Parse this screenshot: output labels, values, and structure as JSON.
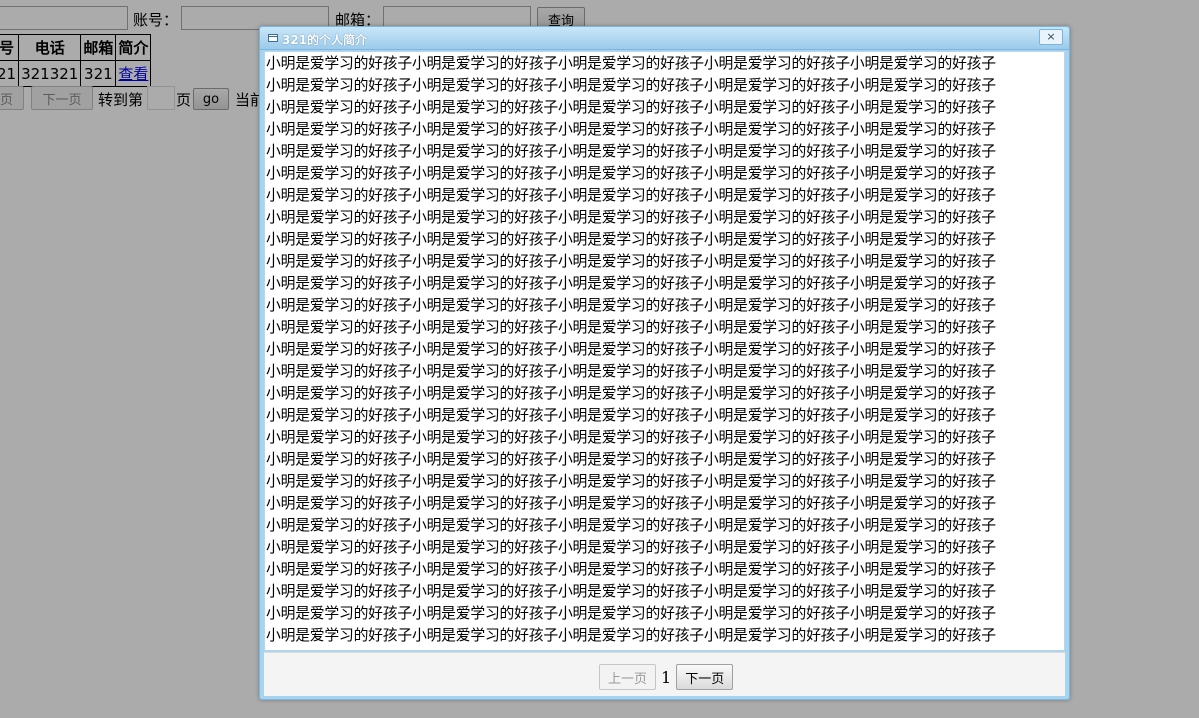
{
  "search": {
    "account_label": "账号：",
    "email_label": "邮箱：",
    "query_button": "查询"
  },
  "table": {
    "headers": [
      "号",
      "电话",
      "邮箱",
      "简介"
    ],
    "rows": [
      {
        "id": "21",
        "phone": "321321",
        "email": "321",
        "link": "查看"
      }
    ]
  },
  "pager": {
    "prev": "页",
    "next": "下一页",
    "goto_label": "转到第",
    "page_label": "页",
    "go_button": "go",
    "current_label": "当前"
  },
  "dialog": {
    "title": "321的个人简介",
    "close_label": "×",
    "content_line": "小明是爱学习的好孩子小明是爱学习的好孩子小明是爱学习的好孩子小明是爱学习的好孩子小明是爱学习的好孩子",
    "footer": {
      "prev": "上一页",
      "page": "1",
      "next": "下一页"
    }
  },
  "colors": {
    "dialog_frame": "#a8d3ee",
    "overlay": "rgba(0,0,0,0.33)",
    "link": "#0000ee"
  }
}
